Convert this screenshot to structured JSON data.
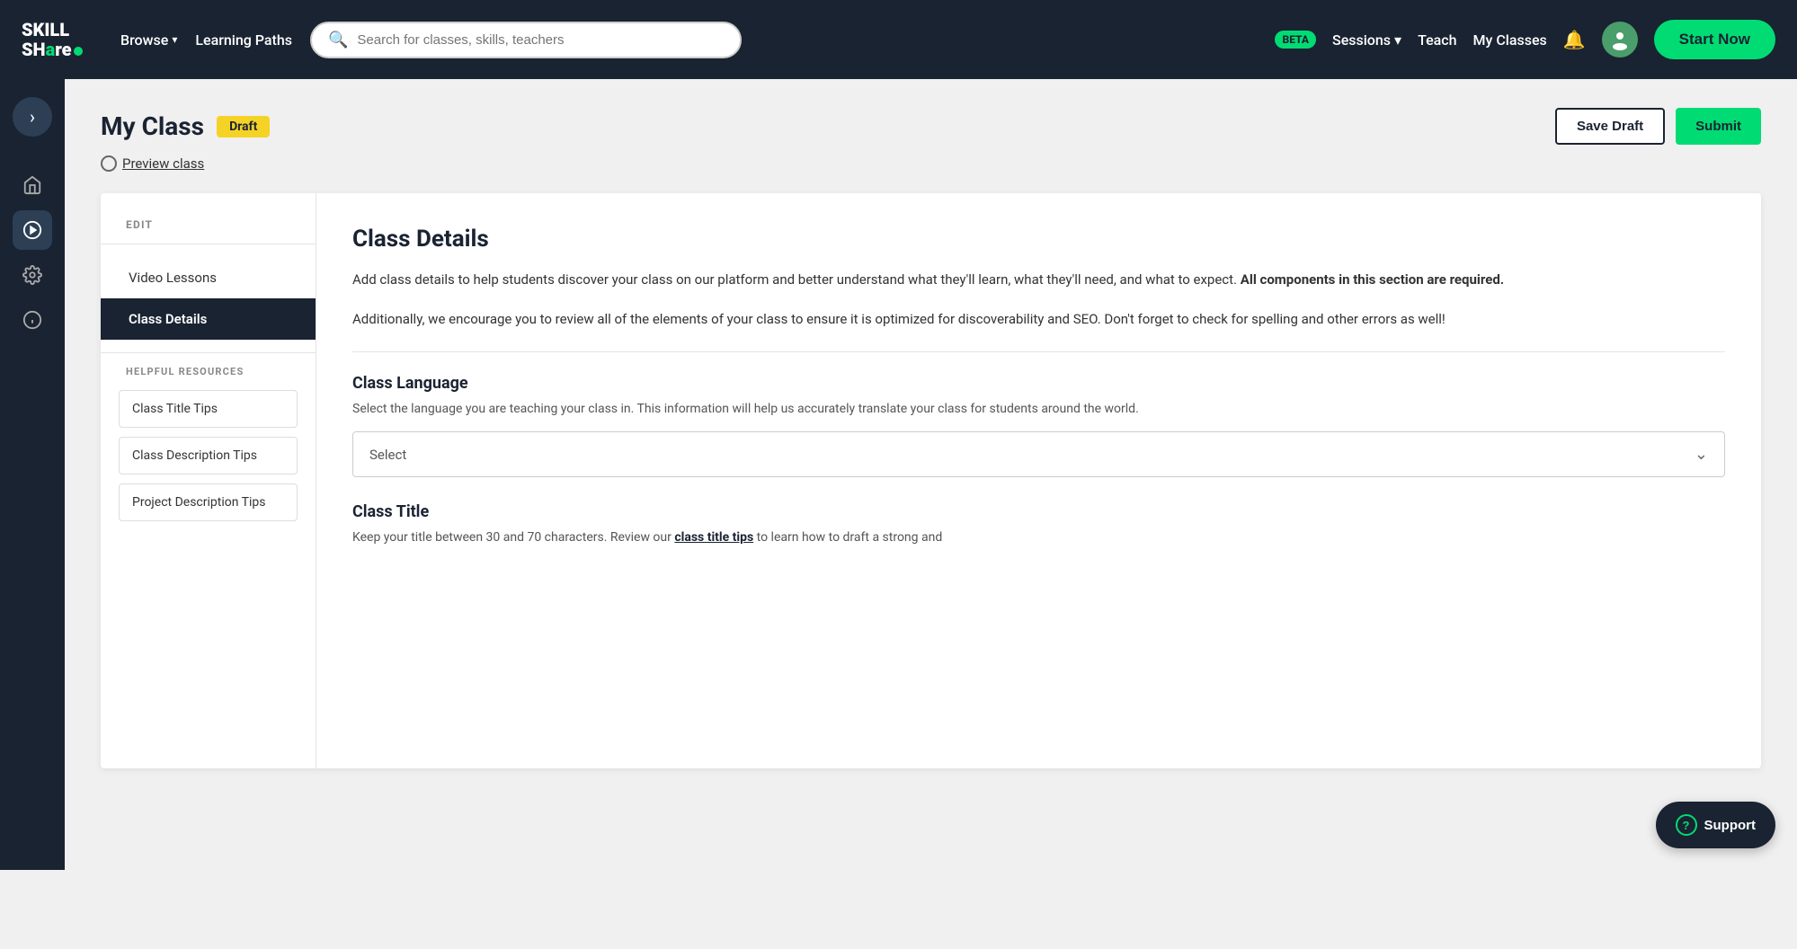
{
  "nav": {
    "logo_line1": "SKILL",
    "logo_line2": "SHare",
    "browse": "Browse",
    "learning_paths": "Learning Paths",
    "search_placeholder": "Search for classes, skills, teachers",
    "beta_label": "BETA",
    "sessions_label": "Sessions",
    "teach_label": "Teach",
    "my_classes_label": "My Classes",
    "start_now_label": "Start Now"
  },
  "sidebar": {
    "chevron_icon": "›",
    "home_icon": "⌂",
    "play_icon": "▶",
    "gear_icon": "⚙",
    "info_icon": "ℹ"
  },
  "page": {
    "title": "My Class",
    "draft_badge": "Draft",
    "save_draft_btn": "Save Draft",
    "submit_btn": "Submit",
    "preview_label": "Preview class"
  },
  "left_panel": {
    "edit_label": "EDIT",
    "video_lessons": "Video Lessons",
    "class_details": "Class Details",
    "helpful_resources_label": "HELPFUL RESOURCES",
    "resource_1": "Class Title Tips",
    "resource_2": "Class Description Tips",
    "resource_3": "Project Description Tips"
  },
  "right_panel": {
    "section_title": "Class Details",
    "desc_1": "Add class details to help students discover your class on our platform and better understand what they'll learn, what they'll need, and what to expect.",
    "desc_1_bold": "All components in this section are required.",
    "desc_2": "Additionally, we encourage you to review all of the elements of your class to ensure it is optimized for discoverability and SEO. Don't forget to check for spelling and other errors as well!",
    "class_language_label": "Class Language",
    "class_language_desc": "Select the language you are teaching your class in. This information will help us accurately translate your class for students around the world.",
    "select_placeholder": "Select",
    "class_title_label": "Class Title",
    "class_title_desc": "Keep your title between 30 and 70 characters. Review our",
    "class_title_link": "class title tips",
    "class_title_desc2": "to learn how to draft a strong and"
  },
  "support": {
    "label": "Support",
    "icon": "?"
  }
}
